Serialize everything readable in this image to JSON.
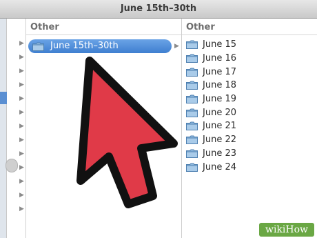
{
  "window": {
    "title": "June 15th–30th"
  },
  "columns": [
    {
      "header": "Other",
      "selected_item": "June 15th–30th"
    },
    {
      "header": "Other",
      "items": [
        "June 15",
        "June 16",
        "June 17",
        "June 18",
        "June 19",
        "June 20",
        "June 21",
        "June 22",
        "June 23",
        "June 24"
      ]
    }
  ],
  "icons": {
    "folder": "folder-icon",
    "disclosure": "disclosure-triangle-icon",
    "pointer": "red-arrow-pointer"
  },
  "colors": {
    "selection": "#3f7fd0",
    "arrow_fill": "#e03a48",
    "arrow_stroke": "#111111",
    "logo_bg": "#6aa744",
    "folder": "#8eb8de"
  },
  "watermark": {
    "text": "wikiHow"
  }
}
